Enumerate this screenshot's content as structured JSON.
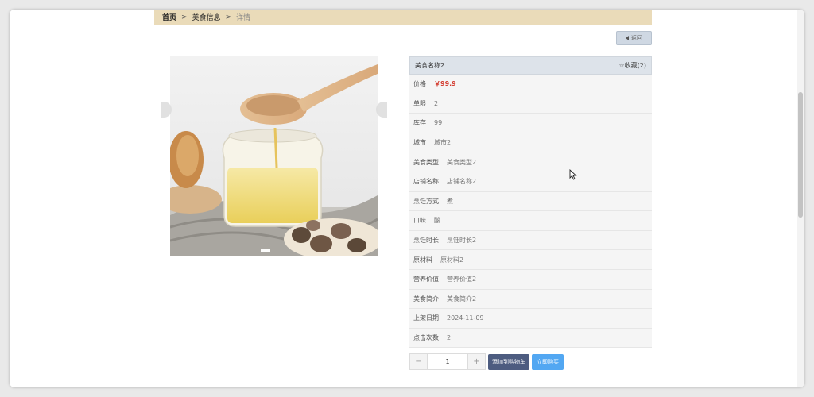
{
  "breadcrumb": {
    "home": "首页",
    "section": "美食信息",
    "current": "详情",
    "separator": ">"
  },
  "back_button": {
    "label": "返回"
  },
  "carousel": {
    "image_description_icon": "honey-jar-with-spoon",
    "active_index": 1,
    "total": 1
  },
  "product": {
    "name": "美食名称2",
    "favorite_label": "☆收藏(2)",
    "details": [
      {
        "label": "价格",
        "value": "￥99.9",
        "highlight": true
      },
      {
        "label": "单限",
        "value": "2"
      },
      {
        "label": "库存",
        "value": "99"
      },
      {
        "label": "城市",
        "value": "城市2"
      },
      {
        "label": "美食类型",
        "value": "美食类型2"
      },
      {
        "label": "店铺名称",
        "value": "店铺名称2"
      },
      {
        "label": "烹饪方式",
        "value": "煮"
      },
      {
        "label": "口味",
        "value": "酸"
      },
      {
        "label": "烹饪时长",
        "value": "烹饪时长2"
      },
      {
        "label": "原材料",
        "value": "原材料2"
      },
      {
        "label": "营养价值",
        "value": "营养价值2"
      },
      {
        "label": "美食简介",
        "value": "美食简介2"
      },
      {
        "label": "上架日期",
        "value": "2024-11-09"
      },
      {
        "label": "点击次数",
        "value": "2"
      }
    ]
  },
  "purchase": {
    "minus": "−",
    "plus": "+",
    "quantity": "1",
    "add_to_cart": "添加到购物车",
    "buy_now": "立即购买"
  },
  "colors": {
    "breadcrumb_bg": "#eadbb9",
    "price": "#d33b2f",
    "cart_button": "#4d5c80",
    "buy_button": "#52a7f2"
  }
}
